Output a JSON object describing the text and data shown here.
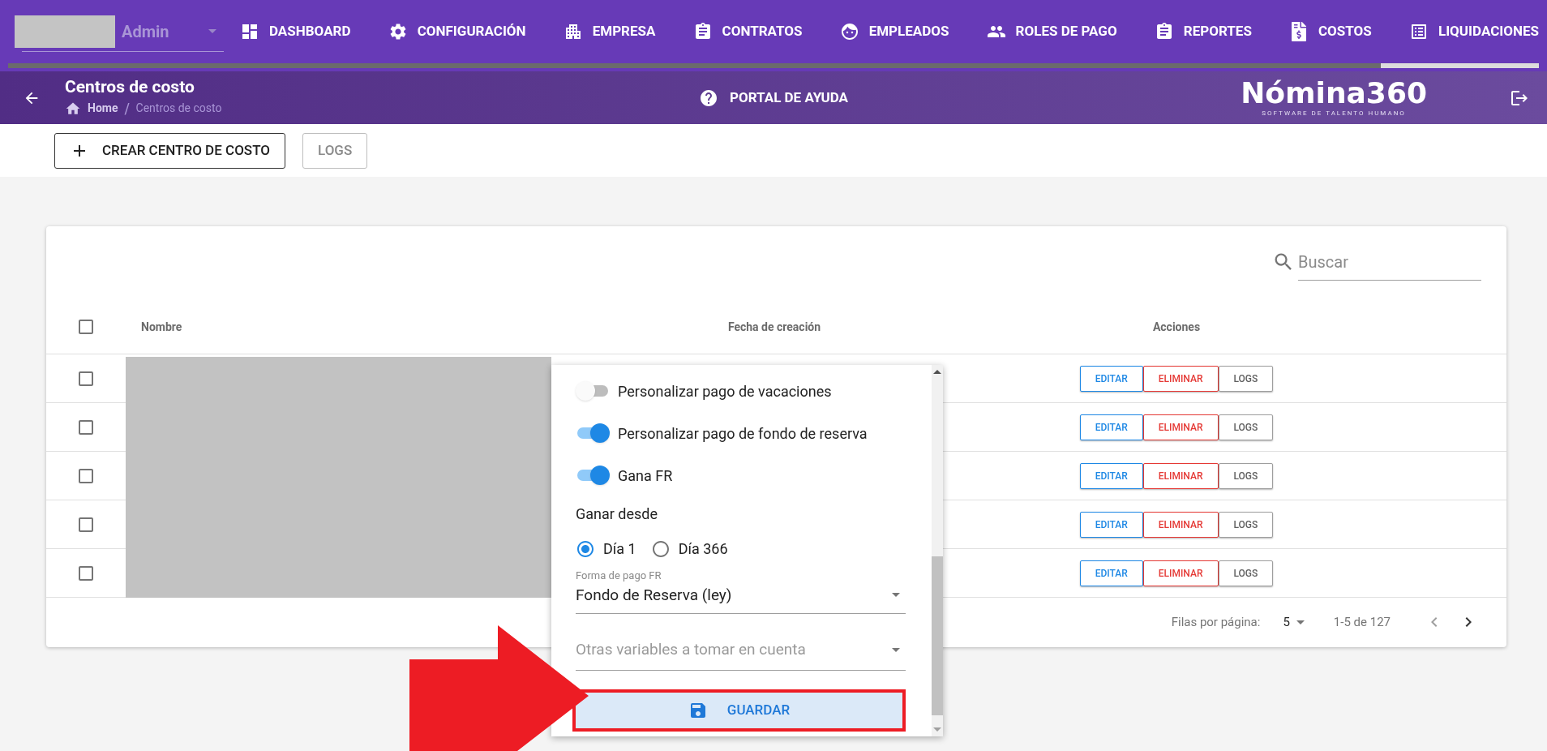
{
  "user": {
    "role": "Admin"
  },
  "nav": [
    {
      "label": "DASHBOARD"
    },
    {
      "label": "CONFIGURACIÓN"
    },
    {
      "label": "EMPRESA"
    },
    {
      "label": "CONTRATOS"
    },
    {
      "label": "EMPLEADOS"
    },
    {
      "label": "ROLES DE PAGO"
    },
    {
      "label": "REPORTES"
    },
    {
      "label": "COSTOS"
    },
    {
      "label": "LIQUIDACIONES"
    }
  ],
  "header": {
    "title": "Centros de costo",
    "breadcrumb": [
      "Home",
      "Centros de costo"
    ],
    "breadcrumb_separator": "/",
    "help": "PORTAL DE AYUDA",
    "logo": {
      "name": "Nómina360",
      "tagline": "SOFTWARE DE TALENTO HUMANO"
    }
  },
  "toolbar": {
    "create": "CREAR CENTRO DE COSTO",
    "logs": "LOGS"
  },
  "table": {
    "search": {
      "placeholder": "Buscar"
    },
    "select_all": {
      "checked": false
    },
    "columns": [
      "Nombre",
      "Fecha de creación",
      "Acciones"
    ],
    "rows": [
      {
        "checked": false,
        "actions": [
          "EDITAR",
          "ELIMINAR",
          "LOGS"
        ]
      },
      {
        "checked": false,
        "actions": [
          "EDITAR",
          "ELIMINAR",
          "LOGS"
        ]
      },
      {
        "checked": false,
        "actions": [
          "EDITAR",
          "ELIMINAR",
          "LOGS"
        ]
      },
      {
        "checked": false,
        "actions": [
          "EDITAR",
          "ELIMINAR",
          "LOGS"
        ]
      },
      {
        "checked": false,
        "actions": [
          "EDITAR",
          "ELIMINAR",
          "LOGS"
        ]
      }
    ],
    "pagination": {
      "rows_per_page_label": "Filas por página:",
      "rows_per_page": "5",
      "range": "1-5 de 127"
    }
  },
  "popup": {
    "switches": [
      {
        "label": "Personalizar pago de vacaciones",
        "on": false
      },
      {
        "label": "Personalizar pago de fondo de reserva",
        "on": true
      },
      {
        "label": "Gana FR",
        "on": true
      }
    ],
    "radio_group": {
      "label": "Ganar desde",
      "options": [
        {
          "label": "Día 1",
          "selected": true
        },
        {
          "label": "Día 366",
          "selected": false
        }
      ]
    },
    "payment_select": {
      "label": "Forma de pago FR",
      "value": "Fondo de Reserva (ley)"
    },
    "variables_select": {
      "placeholder": "Otras variables a tomar en cuenta"
    },
    "save_button": {
      "label": "GUARDAR",
      "highlighted": true
    }
  }
}
